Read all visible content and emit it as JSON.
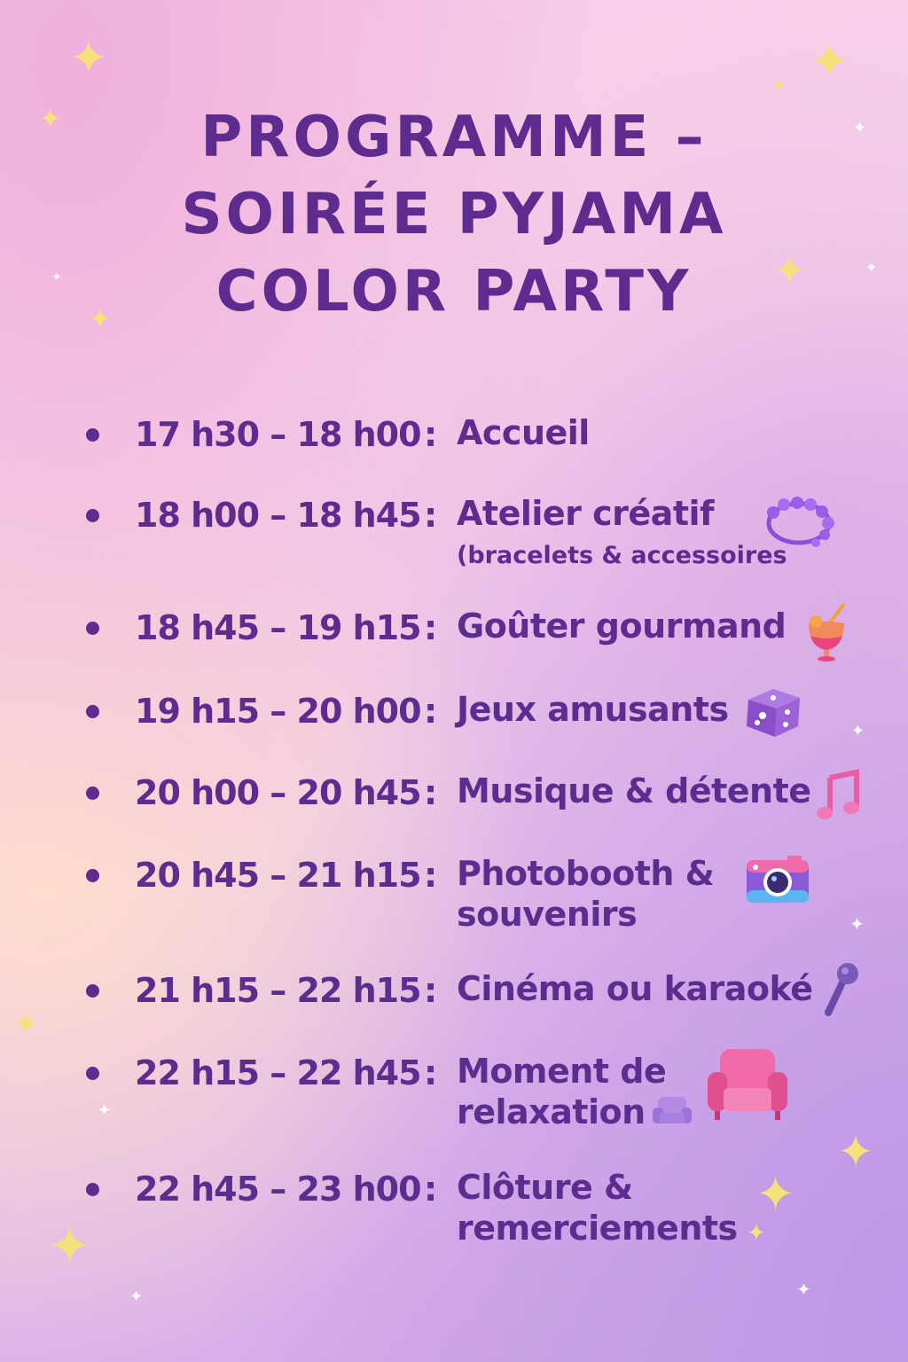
{
  "title": {
    "line1": "PROGRAMME –",
    "line2": "SOIRÉE PYJAMA",
    "line3": "COLOR PARTY"
  },
  "schedule": [
    {
      "time": "17 h30 – 18 h00",
      "activity": [
        "Accueil"
      ]
    },
    {
      "time": "18 h00 – 18 h45",
      "activity": [
        "Atelier créatif"
      ],
      "detail": "(bracelets & accessoires",
      "icon": "bracelet-icon"
    },
    {
      "time": "18 h45 – 19 h15",
      "activity": [
        "Goûter gourmand"
      ],
      "icon": "cocktail-icon"
    },
    {
      "time": "19 h15 – 20 h00",
      "activity": [
        "Jeux amusants"
      ],
      "icon": "dice-icon"
    },
    {
      "time": "20 h00 – 20 h45",
      "activity": [
        "Musique & détente"
      ],
      "icon": "music-note-icon"
    },
    {
      "time": "20 h45 – 21 h15",
      "activity": [
        "Photobooth &",
        "souvenirs"
      ],
      "icon": "camera-icon"
    },
    {
      "time": "21 h15 – 22 h15",
      "activity": [
        "Cinéma ou karaoké"
      ],
      "icon": "microphone-icon"
    },
    {
      "time": "22 h15 – 22 h45",
      "activity": [
        "Moment de",
        "relaxation"
      ],
      "icon": "armchair-icon"
    },
    {
      "time": "22 h45 – 23 h00",
      "activity": [
        "Clôture &",
        "remerciements"
      ]
    }
  ],
  "separator": ":",
  "colors": {
    "text": "#5e2b8f",
    "sparkle": "#f5e27a"
  }
}
